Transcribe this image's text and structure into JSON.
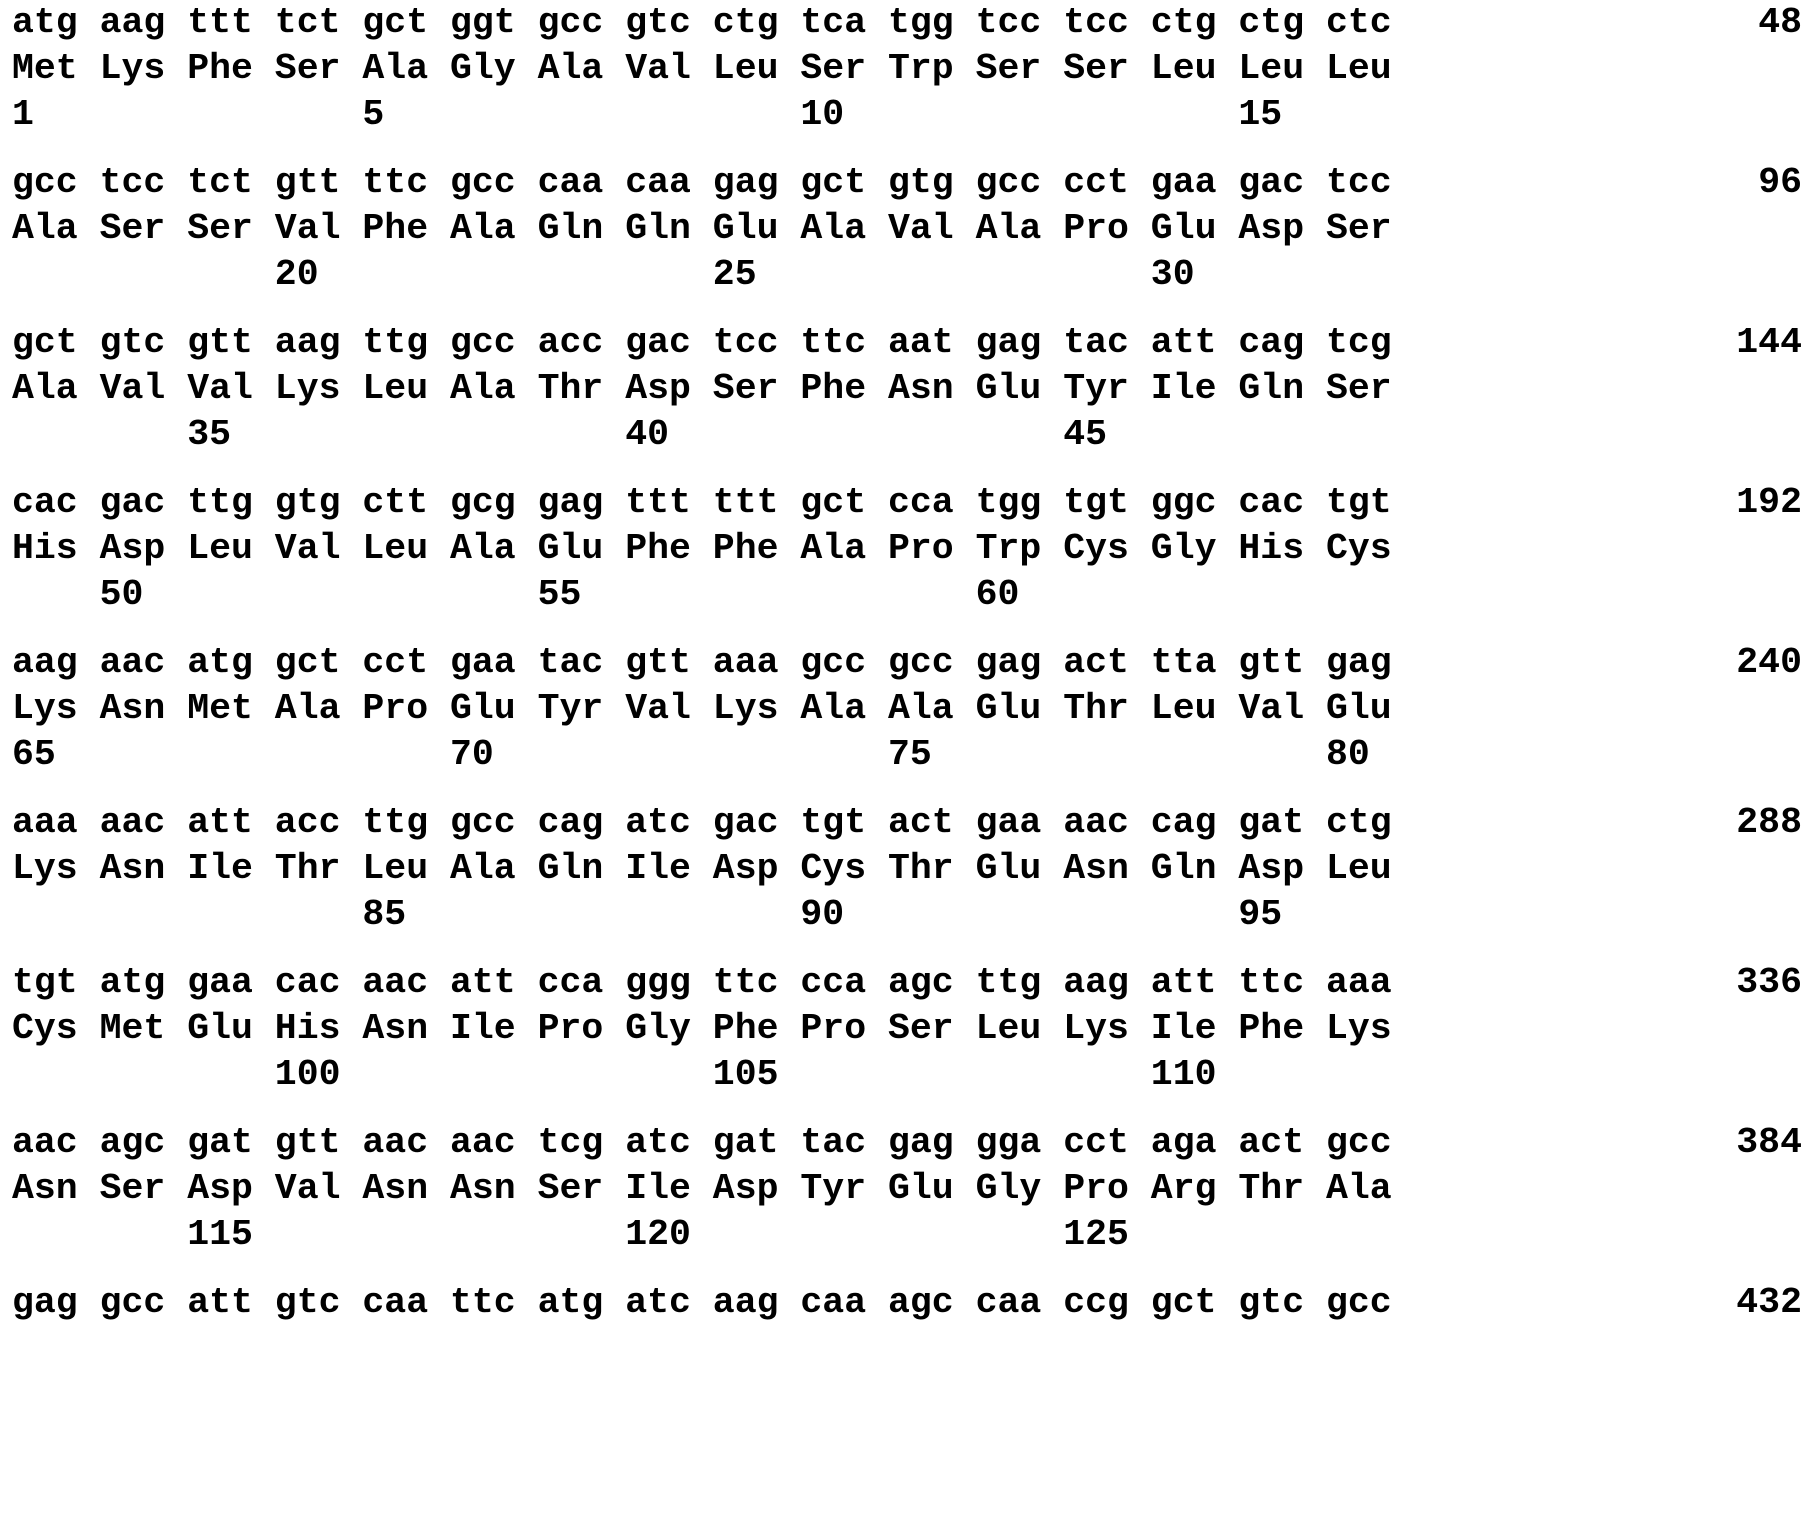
{
  "blocks": [
    {
      "codons": [
        "atg",
        "aag",
        "ttt",
        "tct",
        "gct",
        "ggt",
        "gcc",
        "gtc",
        "ctg",
        "tca",
        "tgg",
        "tcc",
        "tcc",
        "ctg",
        "ctg",
        "ctc"
      ],
      "amino_acids": [
        "Met",
        "Lys",
        "Phe",
        "Ser",
        "Ala",
        "Gly",
        "Ala",
        "Val",
        "Leu",
        "Ser",
        "Trp",
        "Ser",
        "Ser",
        "Leu",
        "Leu",
        "Leu"
      ],
      "positions": [
        {
          "col": 0,
          "num": "1"
        },
        {
          "col": 4,
          "num": "5"
        },
        {
          "col": 9,
          "num": "10"
        },
        {
          "col": 14,
          "num": "15"
        }
      ],
      "total": "48"
    },
    {
      "codons": [
        "gcc",
        "tcc",
        "tct",
        "gtt",
        "ttc",
        "gcc",
        "caa",
        "caa",
        "gag",
        "gct",
        "gtg",
        "gcc",
        "cct",
        "gaa",
        "gac",
        "tcc"
      ],
      "amino_acids": [
        "Ala",
        "Ser",
        "Ser",
        "Val",
        "Phe",
        "Ala",
        "Gln",
        "Gln",
        "Glu",
        "Ala",
        "Val",
        "Ala",
        "Pro",
        "Glu",
        "Asp",
        "Ser"
      ],
      "positions": [
        {
          "col": 3,
          "num": "20"
        },
        {
          "col": 8,
          "num": "25"
        },
        {
          "col": 13,
          "num": "30"
        }
      ],
      "total": "96"
    },
    {
      "codons": [
        "gct",
        "gtc",
        "gtt",
        "aag",
        "ttg",
        "gcc",
        "acc",
        "gac",
        "tcc",
        "ttc",
        "aat",
        "gag",
        "tac",
        "att",
        "cag",
        "tcg"
      ],
      "amino_acids": [
        "Ala",
        "Val",
        "Val",
        "Lys",
        "Leu",
        "Ala",
        "Thr",
        "Asp",
        "Ser",
        "Phe",
        "Asn",
        "Glu",
        "Tyr",
        "Ile",
        "Gln",
        "Ser"
      ],
      "positions": [
        {
          "col": 2,
          "num": "35"
        },
        {
          "col": 7,
          "num": "40"
        },
        {
          "col": 12,
          "num": "45"
        }
      ],
      "total": "144"
    },
    {
      "codons": [
        "cac",
        "gac",
        "ttg",
        "gtg",
        "ctt",
        "gcg",
        "gag",
        "ttt",
        "ttt",
        "gct",
        "cca",
        "tgg",
        "tgt",
        "ggc",
        "cac",
        "tgt"
      ],
      "amino_acids": [
        "His",
        "Asp",
        "Leu",
        "Val",
        "Leu",
        "Ala",
        "Glu",
        "Phe",
        "Phe",
        "Ala",
        "Pro",
        "Trp",
        "Cys",
        "Gly",
        "His",
        "Cys"
      ],
      "positions": [
        {
          "col": 1,
          "num": "50"
        },
        {
          "col": 6,
          "num": "55"
        },
        {
          "col": 11,
          "num": "60"
        }
      ],
      "total": "192"
    },
    {
      "codons": [
        "aag",
        "aac",
        "atg",
        "gct",
        "cct",
        "gaa",
        "tac",
        "gtt",
        "aaa",
        "gcc",
        "gcc",
        "gag",
        "act",
        "tta",
        "gtt",
        "gag"
      ],
      "amino_acids": [
        "Lys",
        "Asn",
        "Met",
        "Ala",
        "Pro",
        "Glu",
        "Tyr",
        "Val",
        "Lys",
        "Ala",
        "Ala",
        "Glu",
        "Thr",
        "Leu",
        "Val",
        "Glu"
      ],
      "positions": [
        {
          "col": 0,
          "num": "65"
        },
        {
          "col": 5,
          "num": "70"
        },
        {
          "col": 10,
          "num": "75"
        },
        {
          "col": 15,
          "num": "80"
        }
      ],
      "total": "240"
    },
    {
      "codons": [
        "aaa",
        "aac",
        "att",
        "acc",
        "ttg",
        "gcc",
        "cag",
        "atc",
        "gac",
        "tgt",
        "act",
        "gaa",
        "aac",
        "cag",
        "gat",
        "ctg"
      ],
      "amino_acids": [
        "Lys",
        "Asn",
        "Ile",
        "Thr",
        "Leu",
        "Ala",
        "Gln",
        "Ile",
        "Asp",
        "Cys",
        "Thr",
        "Glu",
        "Asn",
        "Gln",
        "Asp",
        "Leu"
      ],
      "positions": [
        {
          "col": 4,
          "num": "85"
        },
        {
          "col": 9,
          "num": "90"
        },
        {
          "col": 14,
          "num": "95"
        }
      ],
      "total": "288"
    },
    {
      "codons": [
        "tgt",
        "atg",
        "gaa",
        "cac",
        "aac",
        "att",
        "cca",
        "ggg",
        "ttc",
        "cca",
        "agc",
        "ttg",
        "aag",
        "att",
        "ttc",
        "aaa"
      ],
      "amino_acids": [
        "Cys",
        "Met",
        "Glu",
        "His",
        "Asn",
        "Ile",
        "Pro",
        "Gly",
        "Phe",
        "Pro",
        "Ser",
        "Leu",
        "Lys",
        "Ile",
        "Phe",
        "Lys"
      ],
      "positions": [
        {
          "col": 3,
          "num": "100"
        },
        {
          "col": 8,
          "num": "105"
        },
        {
          "col": 13,
          "num": "110"
        }
      ],
      "total": "336"
    },
    {
      "codons": [
        "aac",
        "agc",
        "gat",
        "gtt",
        "aac",
        "aac",
        "tcg",
        "atc",
        "gat",
        "tac",
        "gag",
        "gga",
        "cct",
        "aga",
        "act",
        "gcc"
      ],
      "amino_acids": [
        "Asn",
        "Ser",
        "Asp",
        "Val",
        "Asn",
        "Asn",
        "Ser",
        "Ile",
        "Asp",
        "Tyr",
        "Glu",
        "Gly",
        "Pro",
        "Arg",
        "Thr",
        "Ala"
      ],
      "positions": [
        {
          "col": 2,
          "num": "115"
        },
        {
          "col": 7,
          "num": "120"
        },
        {
          "col": 12,
          "num": "125"
        }
      ],
      "total": "384"
    },
    {
      "codons": [
        "gag",
        "gcc",
        "att",
        "gtc",
        "caa",
        "ttc",
        "atg",
        "atc",
        "aag",
        "caa",
        "agc",
        "caa",
        "ccg",
        "gct",
        "gtc",
        "gcc"
      ],
      "amino_acids": [],
      "positions": [],
      "total": "432"
    }
  ]
}
